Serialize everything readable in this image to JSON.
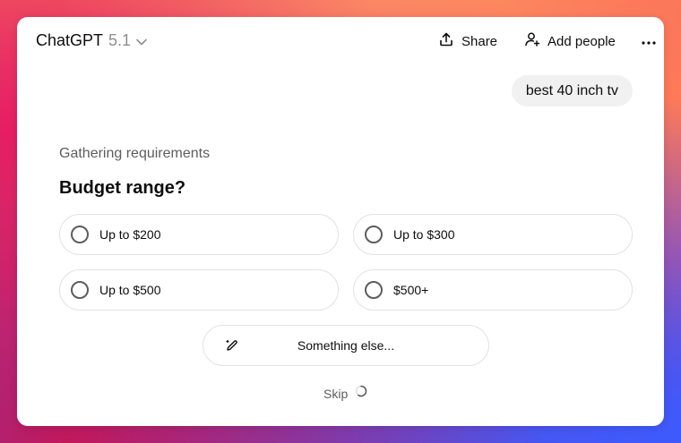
{
  "header": {
    "model_name": "ChatGPT",
    "model_version": "5.1",
    "share_label": "Share",
    "add_people_label": "Add people"
  },
  "conversation": {
    "user_message": "best 40 inch tv"
  },
  "questionnaire": {
    "status": "Gathering requirements",
    "question": "Budget range?",
    "options": [
      {
        "label": "Up to $200",
        "selected": false
      },
      {
        "label": "Up to $300",
        "selected": false
      },
      {
        "label": "Up to $500",
        "selected": false
      },
      {
        "label": "$500+",
        "selected": false
      }
    ],
    "other_label": "Something else...",
    "skip_label": "Skip"
  },
  "icons": {
    "model_dropdown": "chevron-down-icon",
    "share": "share-upload-icon",
    "add_people": "add-person-icon",
    "more": "more-horizontal-icon",
    "other": "pencil-icon",
    "loading": "spinner-icon"
  }
}
